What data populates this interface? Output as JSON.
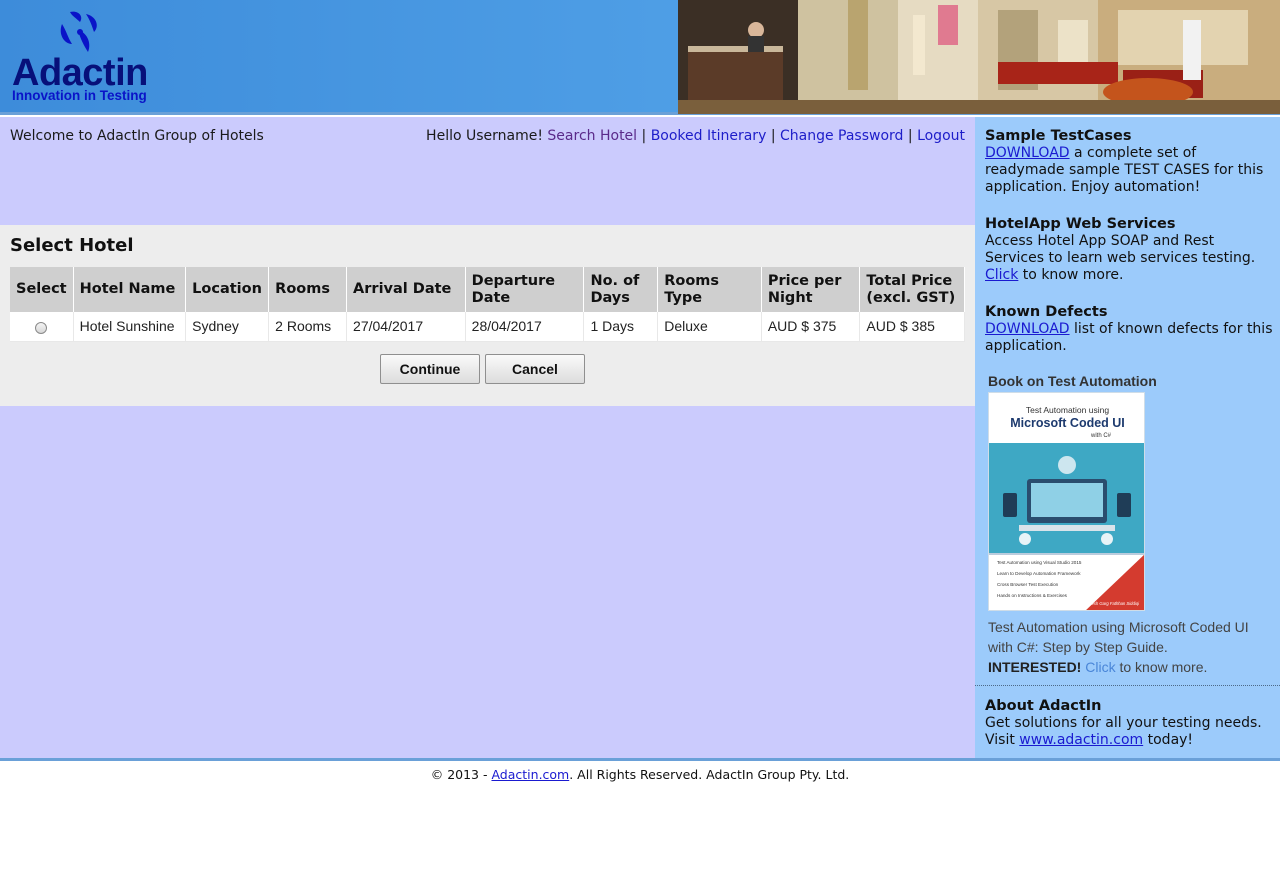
{
  "header": {
    "logo_word": "Adactin",
    "logo_tagline": "Innovation in Testing"
  },
  "welcome": "Welcome to AdactIn Group of Hotels",
  "nav": {
    "greeting": "Hello Username!",
    "links": [
      "Search Hotel",
      "Booked Itinerary",
      "Change Password",
      "Logout"
    ],
    "separator": "|"
  },
  "select_hotel": {
    "title": "Select Hotel",
    "columns": [
      "Select",
      "Hotel Name",
      "Location",
      "Rooms",
      "Arrival Date",
      "Departure Date",
      "No. of Days",
      "Rooms Type",
      "Price per Night",
      "Total Price (excl. GST)"
    ],
    "rows": [
      {
        "hotel_name": "Hotel Sunshine",
        "location": "Sydney",
        "rooms": "2 Rooms",
        "arrival_date": "27/04/2017",
        "departure_date": "28/04/2017",
        "days": "1 Days",
        "rooms_type": "Deluxe",
        "price_per_night": "AUD $ 375",
        "total_price": "AUD $ 385",
        "selected": false
      }
    ],
    "continue_label": "Continue",
    "cancel_label": "Cancel"
  },
  "sidebar": {
    "testcases": {
      "title": "Sample TestCases",
      "link": "DOWNLOAD",
      "text": " a complete set of readymade sample TEST CASES for this application. Enjoy automation!"
    },
    "webservices": {
      "title": "HotelApp Web Services",
      "text": "Access Hotel App SOAP and Rest Services to learn web services testing.",
      "link": "Click",
      "text_after": " to know more."
    },
    "defects": {
      "title": "Known Defects",
      "link": "DOWNLOAD",
      "text": " list of known defects for this application."
    },
    "book": {
      "title": "Book on Test Automation",
      "cover_line1": "Test Automation using",
      "cover_line2": "Microsoft Coded UI",
      "cover_line3": "with C#",
      "cover_bullets": [
        "Test Automation using Visual Studio 2015",
        "Learn to Develop Automation Framework",
        "Cross Browser Test Execution",
        "Hands on Instructions & Exercises"
      ],
      "cover_authors": "Navneesh Garg  Fathhan Siddiqi",
      "description": "Test Automation using Microsoft Coded UI with C#: Step by Step Guide.",
      "interested": "INTERESTED!",
      "link": "Click",
      "text_after": " to know more."
    },
    "about": {
      "title": "About AdactIn",
      "text": "Get solutions for all your testing needs. Visit ",
      "link": "www.adactin.com",
      "text_after": " today!"
    }
  },
  "footer": {
    "prefix": "© 2013 - ",
    "link": "Adactin.com",
    "suffix": ". All Rights Reserved. AdactIn Group Pty. Ltd."
  }
}
